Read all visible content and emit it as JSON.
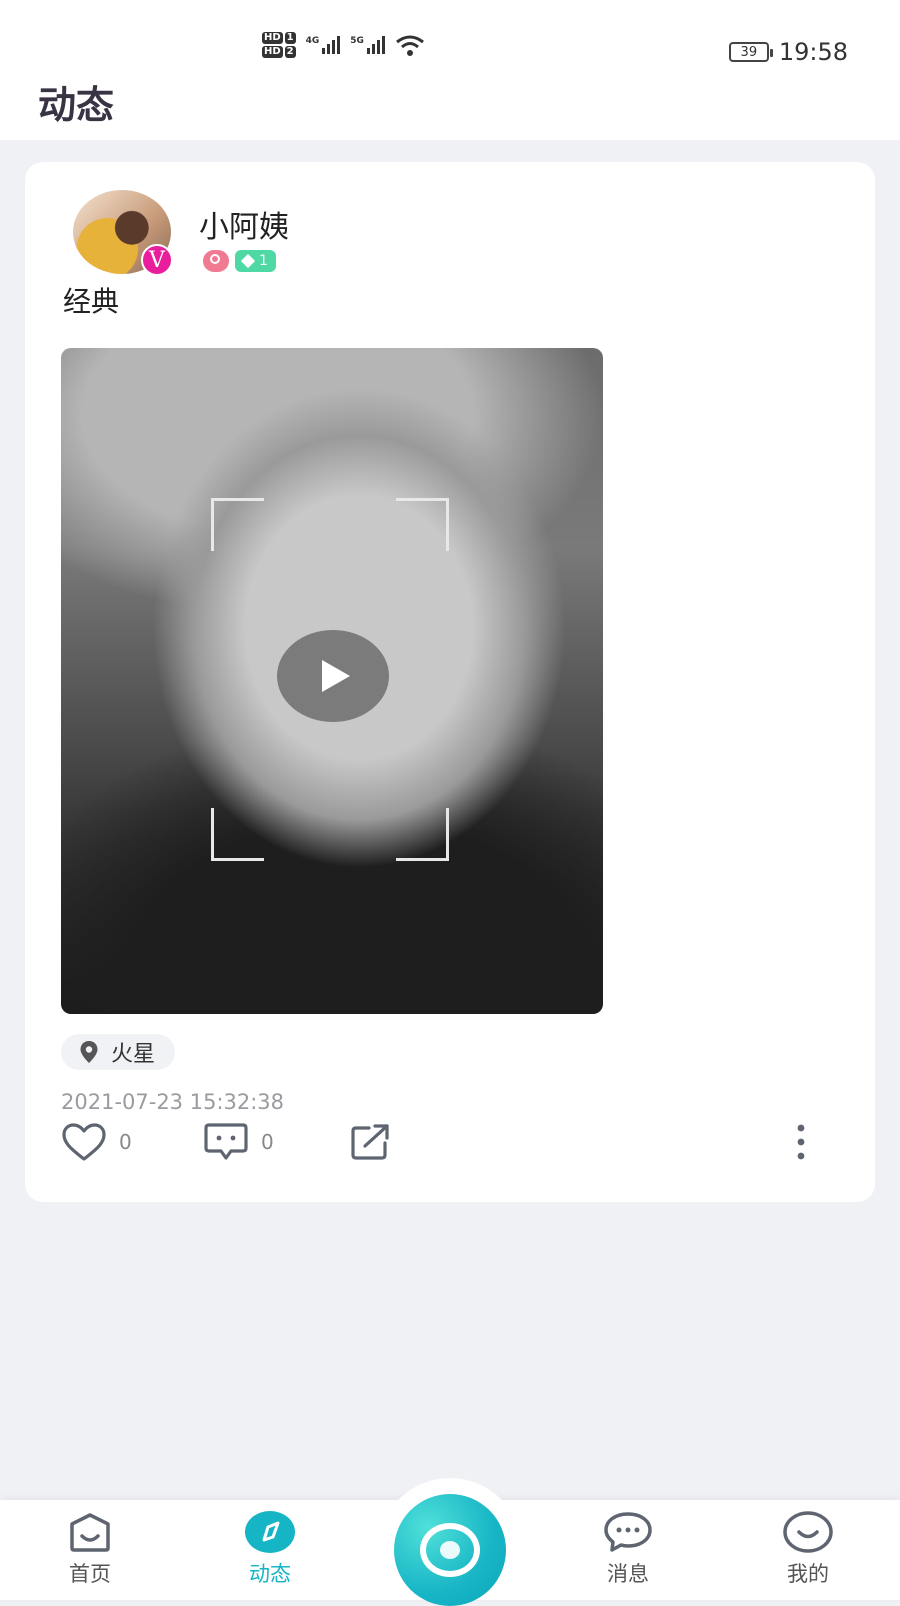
{
  "status_bar": {
    "hd1": "HD",
    "hd1_num": "1",
    "hd2": "HD",
    "hd2_num": "2",
    "net1": "4G",
    "net2": "5G",
    "battery": "39",
    "time": "19:58"
  },
  "header": {
    "title": "动态"
  },
  "post": {
    "username": "小阿姨",
    "avatar_badge": "V",
    "level": "1",
    "text": "经典",
    "location": "火星",
    "timestamp": "2021-07-23 15:32:38",
    "likes": "0",
    "comments": "0"
  },
  "icons": {
    "like": "heart-outline",
    "comment": "comment-bubble",
    "share": "share-external",
    "more": "vertical-dots",
    "location": "map-pin",
    "play": "play-triangle"
  },
  "colors": {
    "accent": "#16b5c6",
    "title": "#3a3344",
    "level_tag": "#4ed8a4",
    "gender_tag": "#f07a92",
    "vip_badge": "#e81e9c"
  },
  "tabbar": {
    "home": "首页",
    "feed": "动态",
    "messages": "消息",
    "me": "我的"
  }
}
